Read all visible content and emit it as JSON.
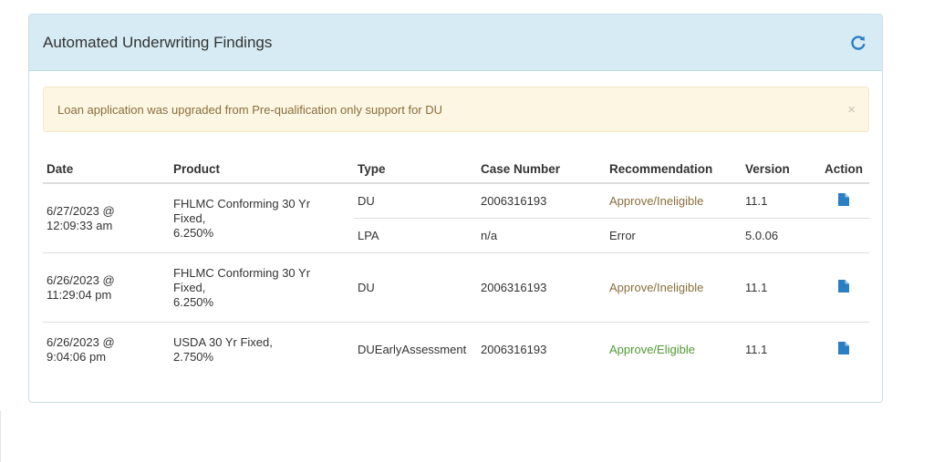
{
  "panel": {
    "title": "Automated Underwriting Findings",
    "refresh_icon": "refresh-icon"
  },
  "alert": {
    "text": "Loan application was upgraded from Pre-qualification only support for DU",
    "close": "×"
  },
  "table": {
    "headers": [
      "Date",
      "Product",
      "Type",
      "Case Number",
      "Recommendation",
      "Version",
      "Action"
    ],
    "rows": [
      {
        "date": "6/27/2023 @ 12:09:33 am",
        "product": "FHLMC Conforming 30 Yr Fixed,",
        "rate": "6.250%",
        "results": [
          {
            "type": "DU",
            "case_number": "2006316193",
            "recommendation": "Approve/Ineligible",
            "version": "11.1",
            "action": "document-icon"
          },
          {
            "type": "LPA",
            "case_number": "n/a",
            "recommendation": "Error",
            "version": "5.0.06",
            "action": ""
          }
        ]
      },
      {
        "date": "6/26/2023 @ 11:29:04 pm",
        "product": "FHLMC Conforming 30 Yr Fixed,",
        "rate": "6.250%",
        "results": [
          {
            "type": "DU",
            "case_number": "2006316193",
            "recommendation": "Approve/Ineligible",
            "version": "11.1",
            "action": "document-icon"
          }
        ]
      },
      {
        "date": "6/26/2023 @ 9:04:06 pm",
        "product": "USDA 30 Yr Fixed,",
        "rate": "2.750%",
        "results": [
          {
            "type": "DUEarlyAssessment",
            "case_number": "2006316193",
            "recommendation": "Approve/Eligible",
            "version": "11.1",
            "action": "document-icon"
          }
        ]
      }
    ]
  },
  "colors": {
    "header_bg": "#d6ebf3",
    "alert_bg": "#fcf6e3",
    "alert_text": "#8a6d3b",
    "link_blue": "#2a7fc4",
    "eligible_green": "#4f9a31"
  }
}
